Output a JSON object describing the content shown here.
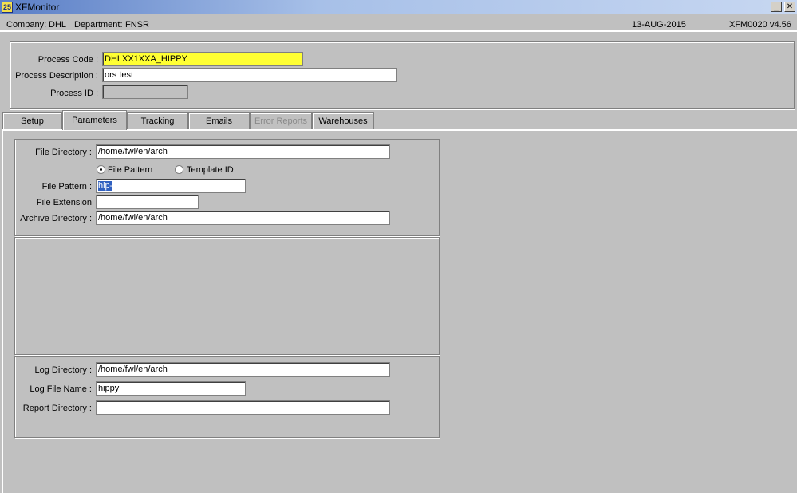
{
  "window": {
    "title": "XFMonitor",
    "icon": "app-icon",
    "minimize_glyph": "_",
    "close_glyph": "✕"
  },
  "status": {
    "company_label": "Company:",
    "company": "DHL",
    "department_label": "Department:",
    "department": "FNSR",
    "date": "13-AUG-2015",
    "form_id": "XFM0020",
    "version": "v4.56"
  },
  "header": {
    "process_code_label": "Process Code :",
    "process_code": "DHLXX1XXA_HIPPY",
    "process_description_label": "Process Description :",
    "process_description": "ors test",
    "process_id_label": "Process ID :",
    "process_id": ""
  },
  "tabs": [
    {
      "label": "Setup"
    },
    {
      "label": "Parameters",
      "active": true
    },
    {
      "label": "Tracking"
    },
    {
      "label": "Emails"
    },
    {
      "label": "Error Reports",
      "disabled": true
    },
    {
      "label": "Warehouses"
    }
  ],
  "parameters": {
    "file_directory_label": "File Directory :",
    "file_directory": "/home/fwl/en/arch",
    "radio_file_pattern_label": "File Pattern",
    "radio_template_id_label": "Template ID",
    "selected_option": "File Pattern",
    "file_pattern_label": "File Pattern :",
    "file_pattern": "hip-",
    "file_extension_label": "File Extension",
    "file_extension": "",
    "archive_directory_label": "Archive Directory :",
    "archive_directory": "/home/fwl/en/arch"
  },
  "logging": {
    "log_directory_label": "Log Directory :",
    "log_directory": "/home/fwl/en/arch",
    "log_file_name_label": "Log File Name :",
    "log_file_name": "hippy",
    "report_directory_label": "Report Directory :",
    "report_directory": ""
  }
}
